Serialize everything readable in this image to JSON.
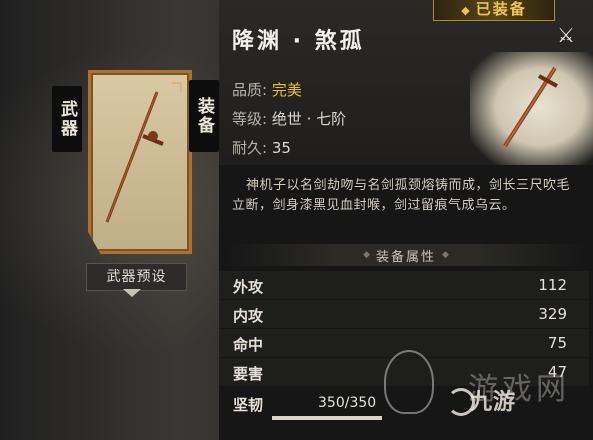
{
  "left_tabs": {
    "weapon": "武器",
    "equip": "装备"
  },
  "preset": {
    "label": "武器预设"
  },
  "badge": {
    "icon": "diamond-icon",
    "label": "已装备"
  },
  "item": {
    "title": "降渊 · 煞孤",
    "quality_label": "品质:",
    "quality_value": "完美",
    "grade_label": "等级:",
    "grade_value": "绝世 · 七阶",
    "durability_label": "耐久:",
    "durability_value": "35",
    "description": "神机子以名剑劫吻与名剑孤颈熔铸而成，剑长三尺吹毛立断，剑身漆黑见血封喉，剑过留痕气成乌云。"
  },
  "attributes": {
    "header": "装备属性",
    "rows": [
      {
        "label": "外攻",
        "value": "112"
      },
      {
        "label": "内攻",
        "value": "329"
      },
      {
        "label": "命中",
        "value": "75"
      },
      {
        "label": "要害",
        "value": "47"
      }
    ]
  },
  "toughness": {
    "label": "坚韧",
    "value": "350/350",
    "fraction": 1.0
  },
  "watermark": {
    "text": "九游",
    "faint": "游戏网"
  },
  "colors": {
    "gold": "#e9c21a",
    "slot_border": "#b0722a",
    "badge_text": "#f0c25a"
  }
}
